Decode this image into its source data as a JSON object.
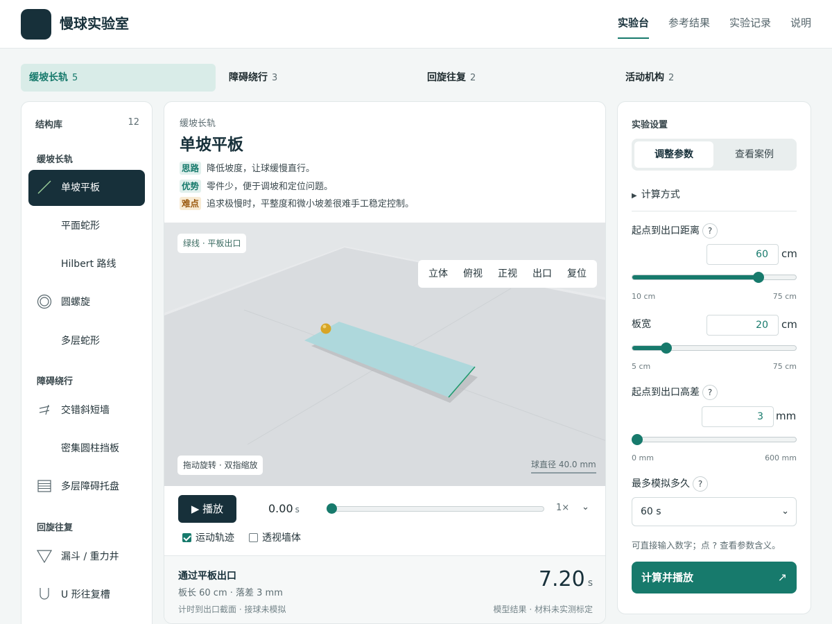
{
  "app": {
    "title": "慢球实验室"
  },
  "nav": [
    {
      "label": "实验台",
      "active": true
    },
    {
      "label": "参考结果",
      "active": false
    },
    {
      "label": "实验记录",
      "active": false
    },
    {
      "label": "说明",
      "active": false
    }
  ],
  "categories": [
    {
      "label": "缓坡长轨",
      "count": "5",
      "active": true
    },
    {
      "label": "障碍绕行",
      "count": "3",
      "active": false
    },
    {
      "label": "回旋往复",
      "count": "2",
      "active": false
    },
    {
      "label": "活动机构",
      "count": "2",
      "active": false
    }
  ],
  "sidebar": {
    "title": "结构库",
    "count": "12",
    "groups": [
      {
        "label": "缓坡长轨",
        "items": [
          {
            "label": "单坡平板",
            "icon": "slope-line-icon",
            "active": true
          },
          {
            "label": "平面蛇形",
            "icon": ""
          },
          {
            "label": "Hilbert 路线",
            "icon": ""
          },
          {
            "label": "圆螺旋",
            "icon": "spiral-icon"
          },
          {
            "label": "多层蛇形",
            "icon": ""
          }
        ]
      },
      {
        "label": "障碍绕行",
        "items": [
          {
            "label": "交错斜短墙",
            "icon": "staggered-walls-icon"
          },
          {
            "label": "密集圆柱挡板",
            "icon": ""
          },
          {
            "label": "多层障碍托盘",
            "icon": "layered-tray-icon"
          }
        ]
      },
      {
        "label": "回旋往复",
        "items": [
          {
            "label": "漏斗 / 重力井",
            "icon": "funnel-icon"
          },
          {
            "label": "U 形往复槽",
            "icon": "u-trough-icon"
          }
        ]
      }
    ]
  },
  "main": {
    "breadcrumb": "缓坡长轨",
    "title": "单坡平板",
    "notes": [
      {
        "tag": "思路",
        "text": "降低坡度，让球缓慢直行。"
      },
      {
        "tag": "优势",
        "text": "零件少，便于调坡和定位问题。"
      },
      {
        "tag": "难点",
        "text": "追求极慢时，平整度和微小坡差很难手工稳定控制。"
      }
    ],
    "viewport": {
      "legend": "绿线 · 平板出口",
      "views": [
        "立体",
        "俯视",
        "正视",
        "出口",
        "复位"
      ],
      "hint": "拖动旋转 · 双指缩放",
      "ball_diameter": "球直径 40.0 mm",
      "colors": {
        "board": "#aed8dc",
        "ball": "#d7a526",
        "exit_line": "#1f9a6e"
      }
    },
    "playback": {
      "play_label": "▶ 播放",
      "time": "0.00",
      "time_unit": "s",
      "progress": 0,
      "speed": "1×",
      "chevron": "⌄",
      "options": [
        {
          "label": "运动轨迹",
          "checked": true
        },
        {
          "label": "透视墙体",
          "checked": false
        }
      ]
    },
    "result": {
      "title": "通过平板出口",
      "subtitle": "板长 60 cm · 落差 3 mm",
      "footnote": "计时到出口截面 · 接球未模拟",
      "value": "7.20",
      "unit": "s",
      "note": "模型结果 · 材料未实测标定"
    }
  },
  "settings": {
    "title": "实验设置",
    "tabs": [
      {
        "label": "调整参数",
        "active": true
      },
      {
        "label": "查看案例",
        "active": false
      }
    ],
    "calc_toggle": "计算方式",
    "fields": [
      {
        "label": "起点到出口距离",
        "help": "?",
        "value": "60",
        "unit": "cm",
        "min": "10 cm",
        "max": "75 cm",
        "fraction": 0.77
      },
      {
        "label": "板宽",
        "help": "",
        "value": "20",
        "unit": "cm",
        "min": "5 cm",
        "max": "75 cm",
        "fraction": 0.21
      },
      {
        "label": "起点到出口高差",
        "help": "?",
        "value": "3",
        "unit": "mm",
        "min": "0 mm",
        "max": "600 mm",
        "fraction": 0.005
      }
    ],
    "duration": {
      "label": "最多模拟多久",
      "help": "?",
      "selected": "60 s",
      "chevron": "⌄"
    },
    "hint": "可直接输入数字；点 ? 查看参数含义。",
    "submit": "计算并播放",
    "submit_icon": "↗",
    "accent": "#177a6c"
  }
}
